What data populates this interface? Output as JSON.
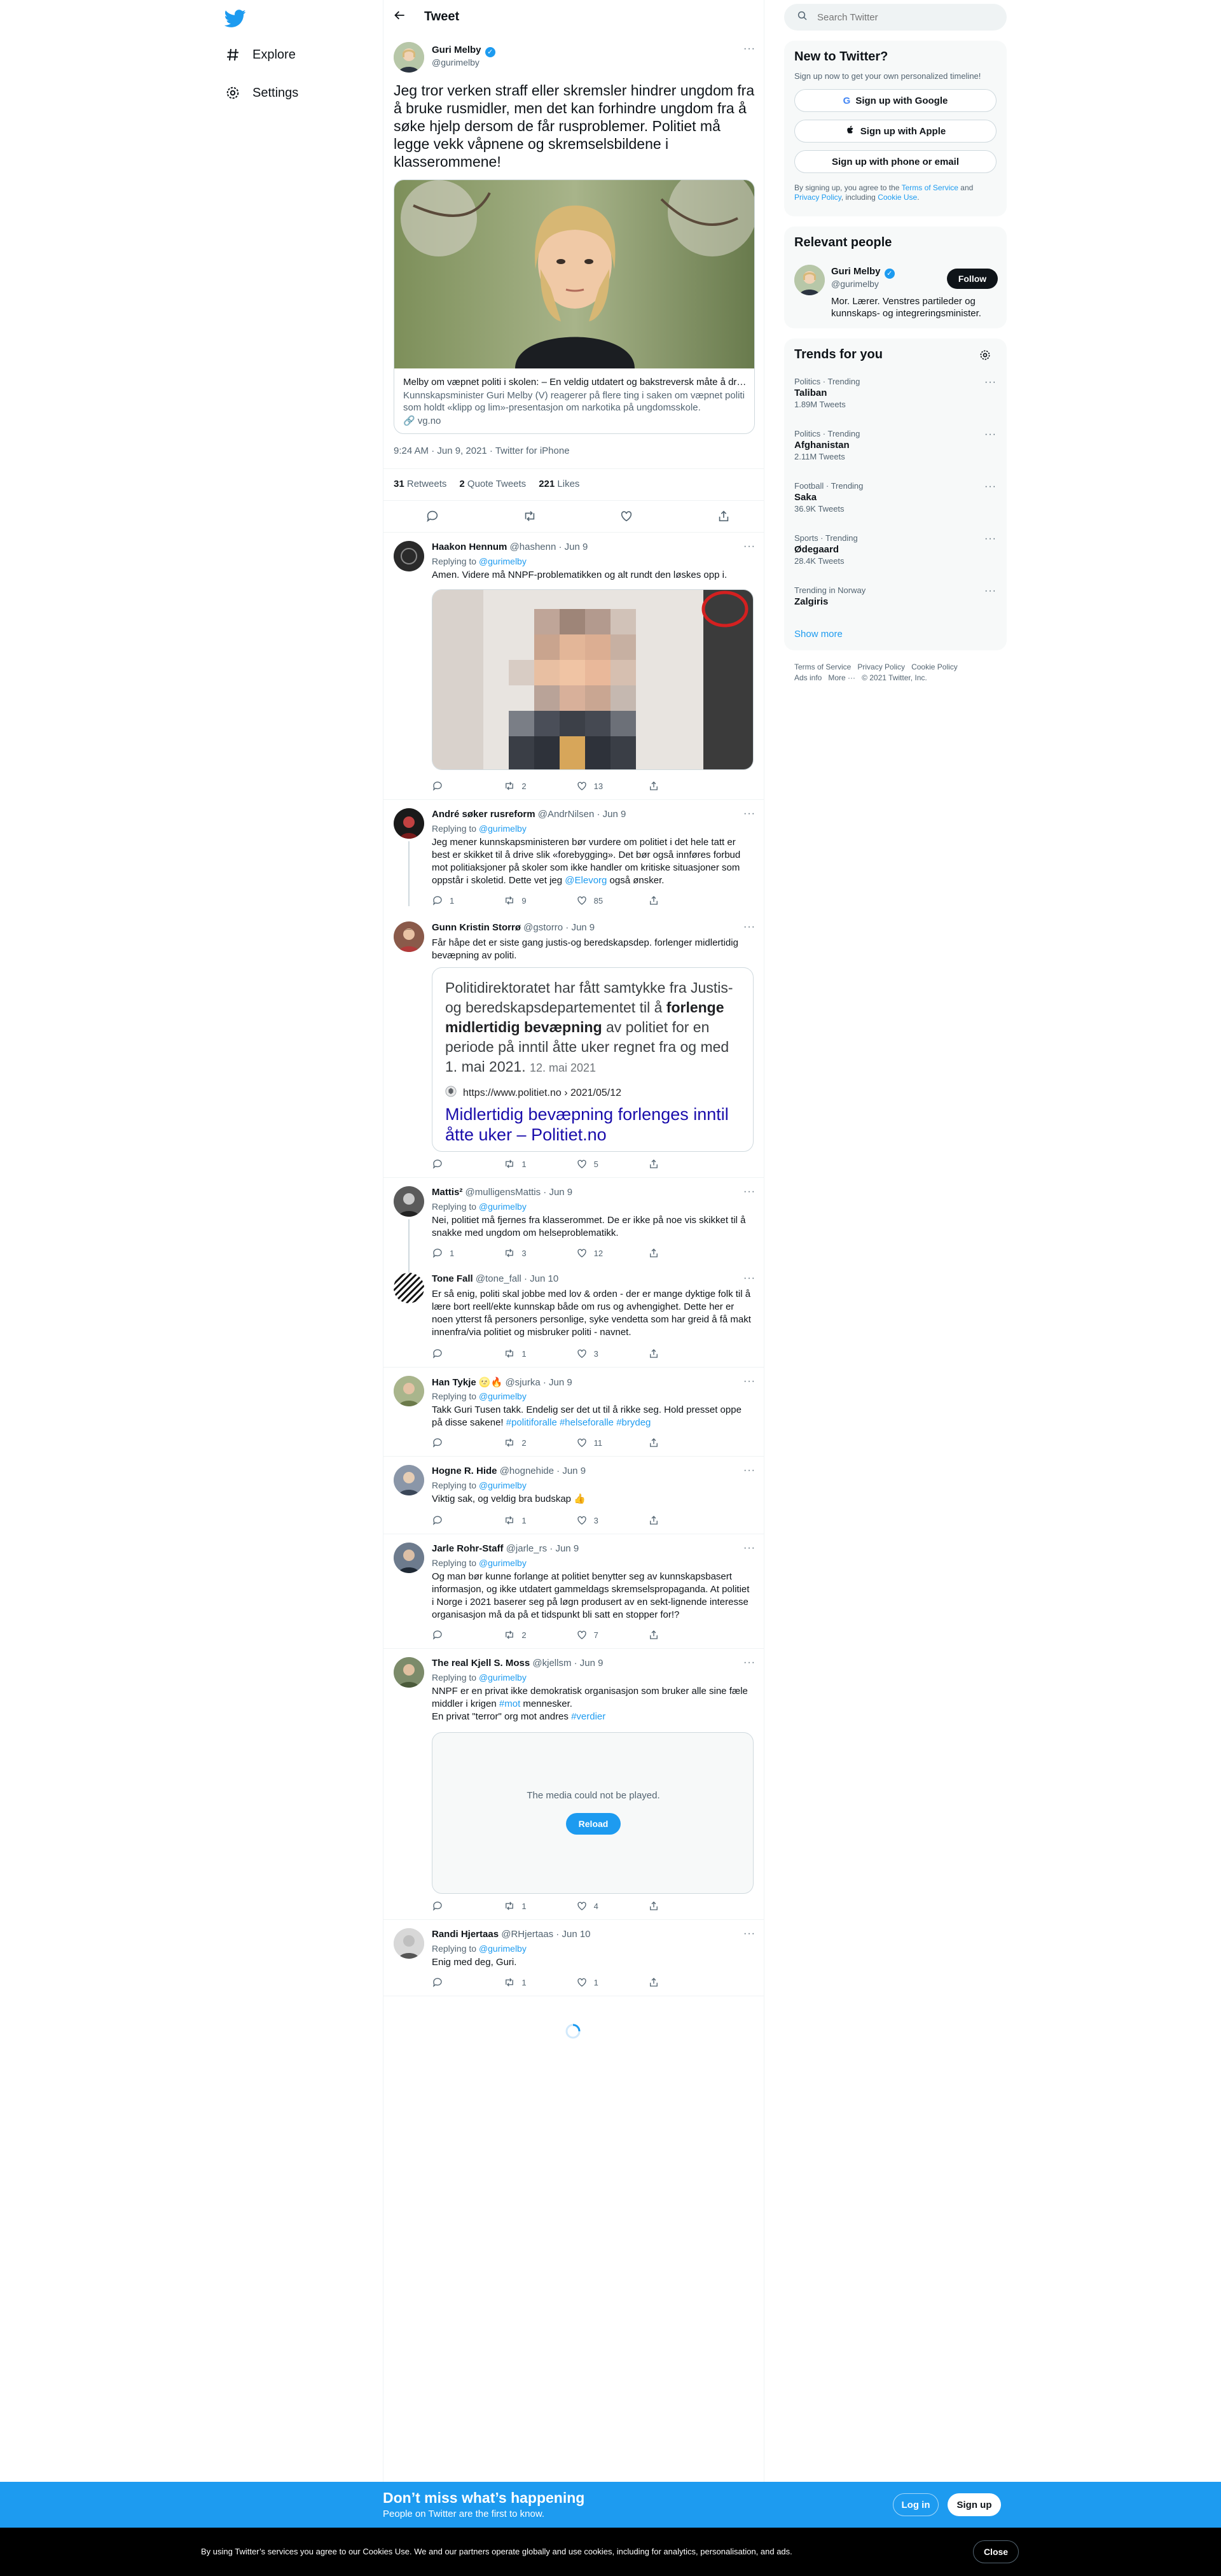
{
  "nav": {
    "explore": "Explore",
    "settings": "Settings"
  },
  "header": {
    "title": "Tweet"
  },
  "main_tweet": {
    "author": "Guri Melby",
    "handle": "@gurimelby",
    "text": "Jeg tror verken straff eller skremsler hindrer ungdom fra å bruke rusmidler, men det kan forhindre ungdom fra å søke hjelp dersom de får rusproblemer. Politiet må legge vekk våpnene og skremselsbildene i klasserommene!",
    "card": {
      "title": "Melby om væpnet politi i skolen: – En veldig utdatert og bakstreversk måte å dr…",
      "description": "Kunnskapsminister Guri Melby (V) reagerer på flere ting i saken om væpnet politi som holdt «klipp og lim»-presentasjon om narkotika på ungdomsskole.",
      "domain": "vg.no"
    },
    "time": "9:24 AM · Jun 9, 2021 · Twitter for iPhone",
    "stats": {
      "retweets": "31",
      "retweets_label": "Retweets",
      "quotes": "2",
      "quotes_label": "Quote Tweets",
      "likes": "221",
      "likes_label": "Likes"
    }
  },
  "replies": [
    {
      "name": "Haakon Hennum",
      "handle": "@hashenn",
      "date": "Jun 9",
      "replying_label": "Replying to",
      "replying_to": "@gurimelby",
      "text": "Amen. Videre må NNPF-problematikken og alt rundt den løskes opp i.",
      "counts": {
        "reply": "",
        "retweet": "2",
        "like": "13"
      }
    },
    {
      "name": "André søker rusreform",
      "handle": "@AndrNilsen",
      "date": "Jun 9",
      "replying_label": "Replying to",
      "replying_to": "@gurimelby",
      "text": "Jeg mener kunnskapsministeren bør vurdere om politiet i det hele tatt er best er skikket til å drive slik «forebygging». Det bør også innføres forbud mot politiaksjoner på skoler som ikke handler om kritiske situasjoner som oppstår i skoletid. Dette vet jeg",
      "mention": "@Elevorg",
      "text_after": "også ønsker.",
      "counts": {
        "reply": "1",
        "retweet": "9",
        "like": "85"
      }
    },
    {
      "name": "Gunn Kristin Storrø",
      "handle": "@gstorro",
      "date": "Jun 9",
      "text": "Får håpe det er siste gang justis-og beredskapsdep. forlenger midlertidig bevæpning av politi.",
      "quote": {
        "text_pre": "Politidirektoratet har fått samtykke fra Justis- og beredskapsdepartementet til å",
        "text_bold": "forlenge midlertidig bevæpning",
        "text_post": "av politiet for en periode på inntil åtte uker regnet fra og med 1. mai 2021.",
        "date": "12. mai 2021",
        "url": "https://www.politiet.no › 2021/05/12",
        "link_title": "Midlertidig bevæpning forlenges inntil åtte uker – Politiet.no"
      },
      "counts": {
        "reply": "",
        "retweet": "1",
        "like": "5"
      }
    },
    {
      "name": "Mattis²",
      "handle": "@mulligensMattis",
      "date": "Jun 9",
      "replying_label": "Replying to",
      "replying_to": "@gurimelby",
      "text": "Nei, politiet må fjernes fra klasserommet. De er ikke på noe vis skikket til å snakke med ungdom om helseproblematikk.",
      "counts": {
        "reply": "1",
        "retweet": "3",
        "like": "12"
      }
    },
    {
      "name": "Tone Fall",
      "handle": "@tone_fall",
      "date": "Jun 10",
      "text": "Er så enig, politi skal jobbe med lov & orden - der er mange dyktige folk til å lære bort reell/ekte kunnskap både om rus og avhengighet. Dette her er noen ytterst få personers personlige, syke vendetta som har greid å få makt innenfra/via politiet og misbruker politi - navnet.",
      "counts": {
        "reply": "",
        "retweet": "1",
        "like": "3"
      }
    },
    {
      "name": "Han Tykje",
      "name_emoji": "🌝🔥",
      "handle": "@sjurka",
      "date": "Jun 9",
      "replying_label": "Replying to",
      "replying_to": "@gurimelby",
      "text": "Takk Guri Tusen takk. Endelig ser det ut til å rikke seg. Hold presset oppe på disse sakene!",
      "hashtags": "#politiforalle #helseforalle #brydeg",
      "counts": {
        "reply": "",
        "retweet": "2",
        "like": "11"
      }
    },
    {
      "name": "Hogne R. Hide",
      "handle": "@hognehide",
      "date": "Jun 9",
      "replying_label": "Replying to",
      "replying_to": "@gurimelby",
      "text": "Viktig sak, og veldig bra budskap 👍",
      "counts": {
        "reply": "",
        "retweet": "1",
        "like": "3"
      }
    },
    {
      "name": "Jarle Rohr-Staff",
      "handle": "@jarle_rs",
      "date": "Jun 9",
      "replying_label": "Replying to",
      "replying_to": "@gurimelby",
      "text": "Og man bør kunne forlange at politiet benytter seg av kunnskapsbasert informasjon, og ikke utdatert gammeldags skremselspropaganda. At politiet i Norge i 2021 baserer seg på løgn produsert av en sekt-lignende interesse organisasjon må da på et tidspunkt bli satt en stopper for!?",
      "counts": {
        "reply": "",
        "retweet": "2",
        "like": "7"
      }
    },
    {
      "name": "The real Kjell S. Moss",
      "handle": "@kjellsm",
      "date": "Jun 9",
      "replying_label": "Replying to",
      "replying_to": "@gurimelby",
      "text_line1": "NNPF er en privat ikke demokratisk organisasjon som bruker alle sine fæle middler i krigen",
      "tag1": "#mot",
      "text_line1b": "mennesker.",
      "text_line2": "En privat \"terror\" org mot andres",
      "tag2": "#verdier",
      "media_error": "The media could not be played.",
      "reload": "Reload",
      "counts": {
        "reply": "",
        "retweet": "1",
        "like": "4"
      }
    },
    {
      "name": "Randi Hjertaas",
      "handle": "@RHjertaas",
      "date": "Jun 10",
      "replying_label": "Replying to",
      "replying_to": "@gurimelby",
      "text": "Enig med deg,  Guri.",
      "counts": {
        "reply": "",
        "retweet": "1",
        "like": "1"
      }
    }
  ],
  "search": {
    "placeholder": "Search Twitter"
  },
  "new_to_twitter": {
    "title": "New to Twitter?",
    "subtitle": "Sign up now to get your own personalized timeline!",
    "google": "Sign up with Google",
    "apple": "Sign up with Apple",
    "phone": "Sign up with phone or email",
    "legal_1": "By signing up, you agree to the",
    "terms": "Terms of Service",
    "legal_2": "and",
    "privacy": "Privacy Policy",
    "legal_3": ", including",
    "cookie": "Cookie Use",
    "legal_4": "."
  },
  "relevant": {
    "title": "Relevant people",
    "name": "Guri Melby",
    "handle": "@gurimelby",
    "follow": "Follow",
    "bio": "Mor. Lærer. Venstres partileder og kunnskaps- og integreringsminister."
  },
  "trends": {
    "title": "Trends for you",
    "items": [
      {
        "category": "Politics · Trending",
        "name": "Taliban",
        "count": "1.89M Tweets"
      },
      {
        "category": "Politics · Trending",
        "name": "Afghanistan",
        "count": "2.11M Tweets"
      },
      {
        "category": "Football · Trending",
        "name": "Saka",
        "count": "36.9K Tweets"
      },
      {
        "category": "Sports · Trending",
        "name": "Ødegaard",
        "count": "28.4K Tweets"
      },
      {
        "category": "Trending in Norway",
        "name": "Zalgiris",
        "count": ""
      }
    ],
    "show_more": "Show more"
  },
  "footer": {
    "terms": "Terms of Service",
    "privacy": "Privacy Policy",
    "cookie": "Cookie Policy",
    "ads": "Ads info",
    "more": "More ···",
    "copyright": "© 2021 Twitter, Inc."
  },
  "signup_bar": {
    "title": "Don’t miss what’s happening",
    "subtitle": "People on Twitter are the first to know.",
    "login": "Log in",
    "signup": "Sign up"
  },
  "cookie_bar": {
    "text": "By using Twitter’s services you agree to our Cookies Use. We and our partners operate globally and use cookies, including for analytics, personalisation, and ads.",
    "close": "Close"
  },
  "colors": {
    "accent": "#1d9bf0",
    "text": "#0f1419",
    "muted": "#536471",
    "border": "#eff3f4"
  }
}
